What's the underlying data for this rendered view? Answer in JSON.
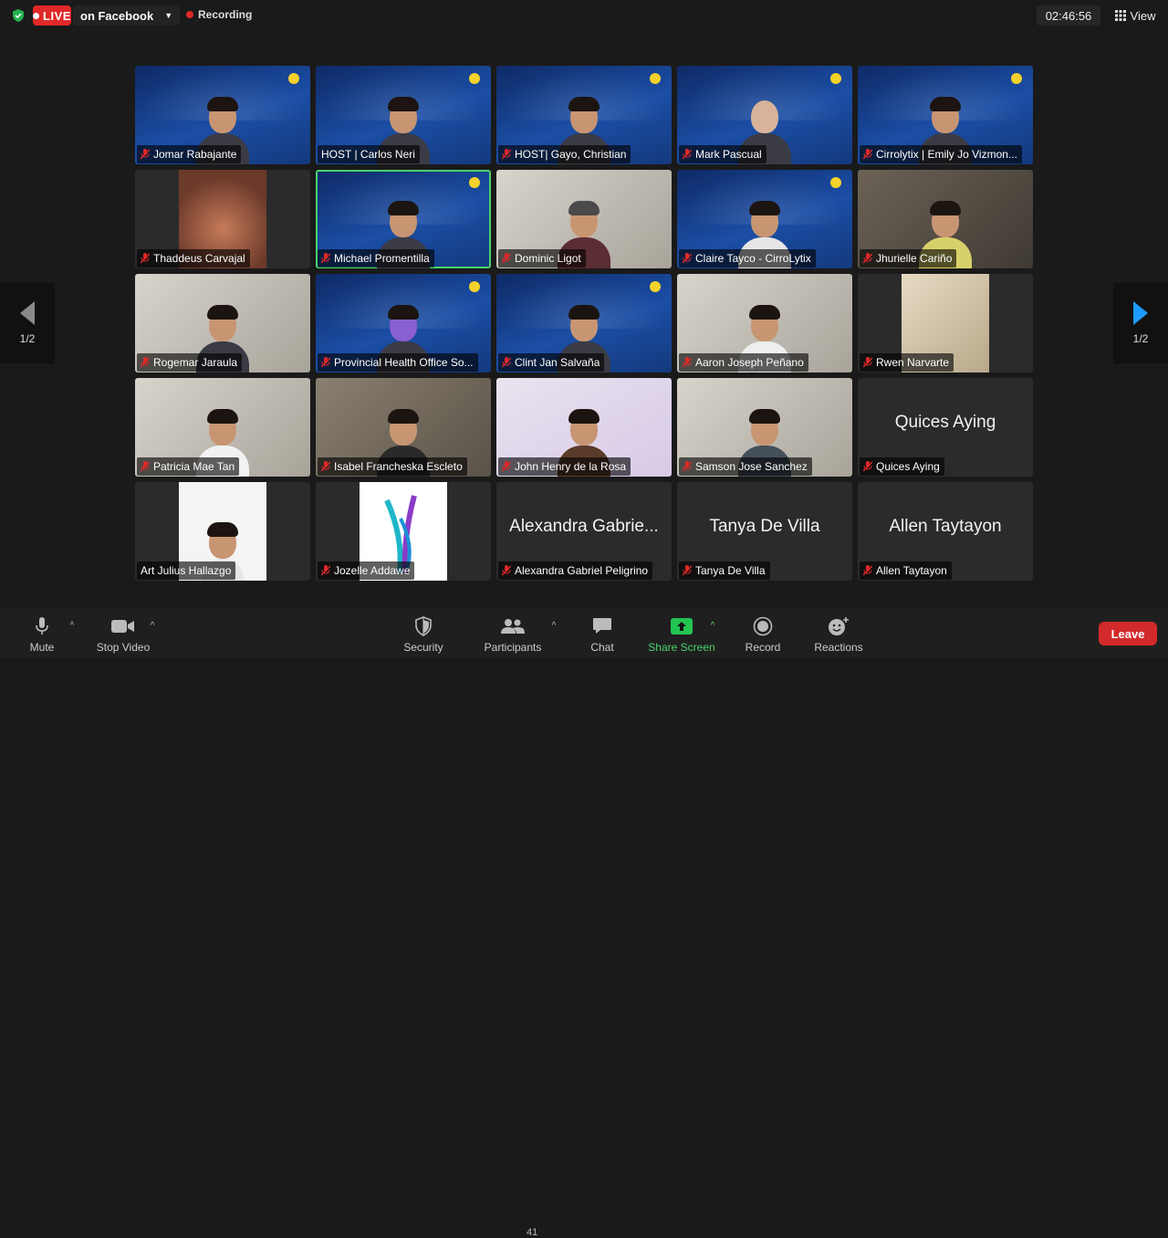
{
  "topbar": {
    "live_label": "LIVE",
    "live_target": "on Facebook",
    "recording_label": "Recording",
    "clock": "02:46:56",
    "view_label": "View"
  },
  "pager": {
    "left_page": "1/2",
    "right_page": "1/2"
  },
  "participants": [
    {
      "name": "Jomar Rabajante",
      "muted": true
    },
    {
      "name": "HOST | Carlos Neri",
      "muted": false
    },
    {
      "name": "HOST| Gayo, Christian",
      "muted": true
    },
    {
      "name": "Mark Pascual",
      "muted": true
    },
    {
      "name": "Cirrolytix | Emily Jo Vizmon...",
      "muted": true
    },
    {
      "name": "Thaddeus Carvajal",
      "muted": true
    },
    {
      "name": "Michael Promentilla",
      "muted": true
    },
    {
      "name": "Dominic Ligot",
      "muted": true
    },
    {
      "name": "Claire Tayco - CirroLytix",
      "muted": true
    },
    {
      "name": "Jhurielle Cariño",
      "muted": true
    },
    {
      "name": "Rogemar Jaraula",
      "muted": true
    },
    {
      "name": "Provincial Health Office So...",
      "muted": true
    },
    {
      "name": "Clint Jan Salvaña",
      "muted": true
    },
    {
      "name": "Aaron Joseph Peñano",
      "muted": true
    },
    {
      "name": "Rwen Narvarte",
      "muted": true
    },
    {
      "name": "Patricia Mae Tan",
      "muted": true
    },
    {
      "name": "Isabel Francheska Escleto",
      "muted": true
    },
    {
      "name": "John Henry de la Rosa",
      "muted": true
    },
    {
      "name": "Samson Jose Sanchez",
      "muted": true
    },
    {
      "name": "Quices Aying",
      "muted": true,
      "display_name": "Quices Aying"
    },
    {
      "name": "Art Julius Hallazgo",
      "muted": false
    },
    {
      "name": "Jozelle Addawe",
      "muted": true
    },
    {
      "name": "Alexandra Gabriel Peligrino",
      "muted": true,
      "display_name": "Alexandra Gabrie..."
    },
    {
      "name": "Tanya De Villa",
      "muted": true,
      "display_name": "Tanya De Villa"
    },
    {
      "name": "Allen Taytayon",
      "muted": true,
      "display_name": "Allen Taytayon"
    }
  ],
  "toolbar": {
    "mute": "Mute",
    "stop_video": "Stop Video",
    "security": "Security",
    "participants": "Participants",
    "participants_count": "41",
    "chat": "Chat",
    "share_screen": "Share Screen",
    "record": "Record",
    "reactions": "Reactions",
    "leave": "Leave"
  },
  "colors": {
    "live": "#e02828",
    "active_speaker": "#4ad36b",
    "share": "#4ad36b",
    "leave": "#d22a2a"
  }
}
